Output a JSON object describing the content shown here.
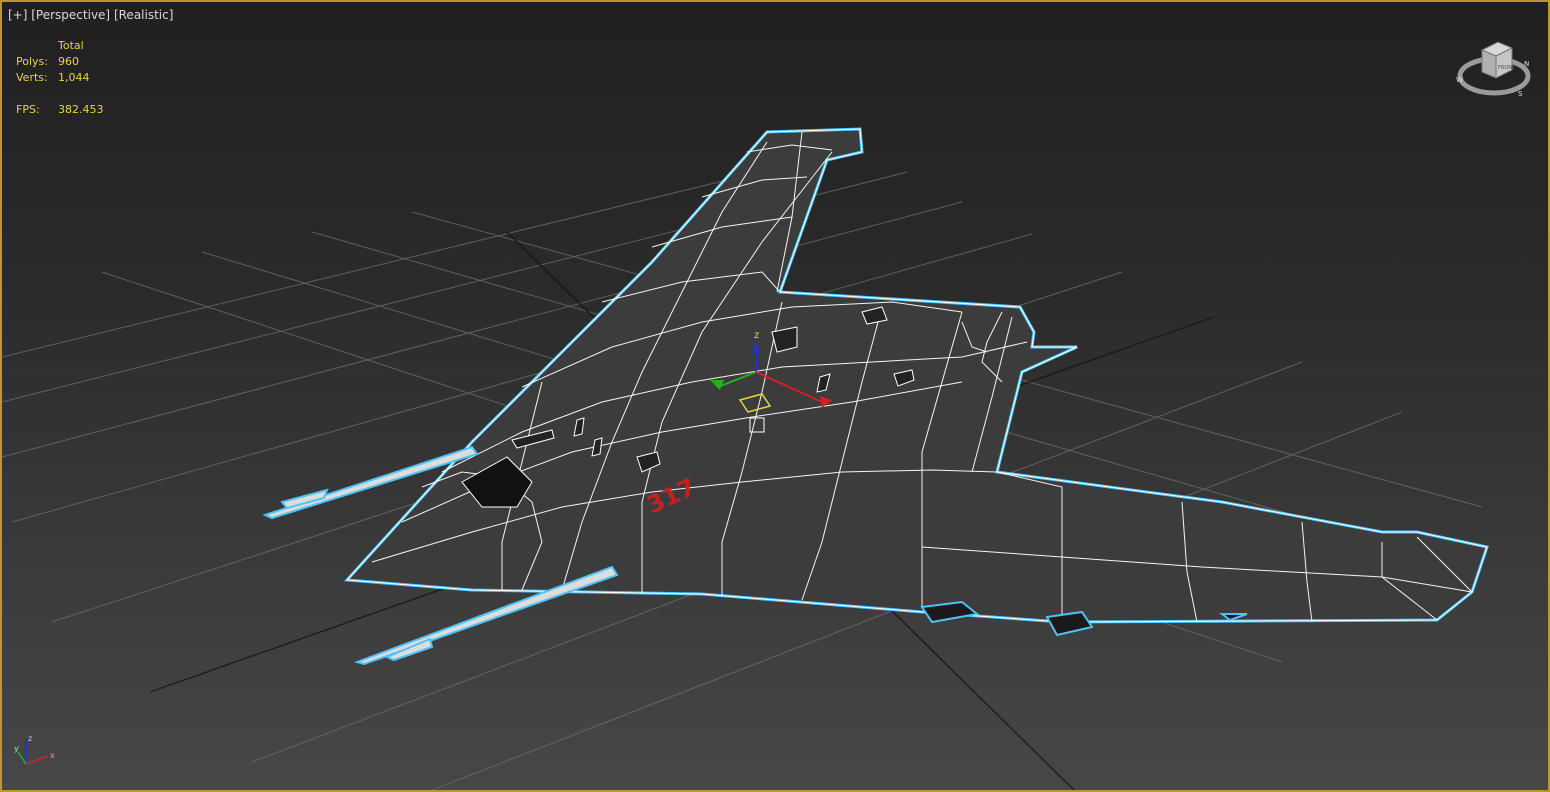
{
  "viewport": {
    "label_parts": [
      "[+]",
      "[Perspective]",
      "[Realistic]"
    ],
    "border_color": "#b89a2c"
  },
  "stats": {
    "header": "Total",
    "polys_label": "Polys:",
    "polys_value": "960",
    "verts_label": "Verts:",
    "verts_value": "1,044",
    "fps_label": "FPS:",
    "fps_value": "382.453",
    "text_color": "#e8d440"
  },
  "viewcube": {
    "face_label": "FRONT",
    "compass_n": "N",
    "compass_s": "S",
    "compass_w": "W"
  },
  "model": {
    "hull_number": "317",
    "selection_color": "#4fc3f7",
    "wire_color": "#ffffff"
  },
  "gizmo": {
    "z_label": "z",
    "x_color": "#d42020",
    "y_color": "#22b020",
    "z_color": "#2030e0"
  },
  "axis_tripod": {
    "x_label": "x",
    "y_label": "y",
    "z_label": "z"
  }
}
